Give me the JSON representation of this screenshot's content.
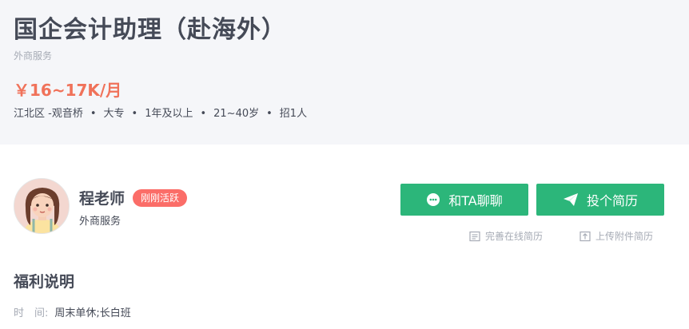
{
  "job": {
    "title": "国企会计助理（赴海外）",
    "company": "外商服务",
    "salary": "￥16~17K/月",
    "meta": [
      "江北区 -观音桥",
      "大专",
      "1年及以上",
      "21~40岁",
      "招1人"
    ]
  },
  "recruiter": {
    "name": "程老师",
    "badge": "刚刚活跃",
    "company": "外商服务"
  },
  "actions": {
    "chat_label": "和TA聊聊",
    "resume_label": "投个简历",
    "online_resume_label": "完善在线简历",
    "upload_resume_label": "上传附件简历"
  },
  "benefits": {
    "title": "福利说明",
    "time_label": "时　间:",
    "time_value": "周末单休;长白班"
  },
  "colors": {
    "accent_green": "#2cb67a",
    "salary_red": "#f0725a",
    "badge_red": "#fb6d68"
  },
  "icons": {
    "chat": "chat-bubble-icon",
    "send": "paper-plane-icon",
    "document": "document-icon",
    "upload": "upload-icon",
    "avatar": "avatar-illustration"
  }
}
